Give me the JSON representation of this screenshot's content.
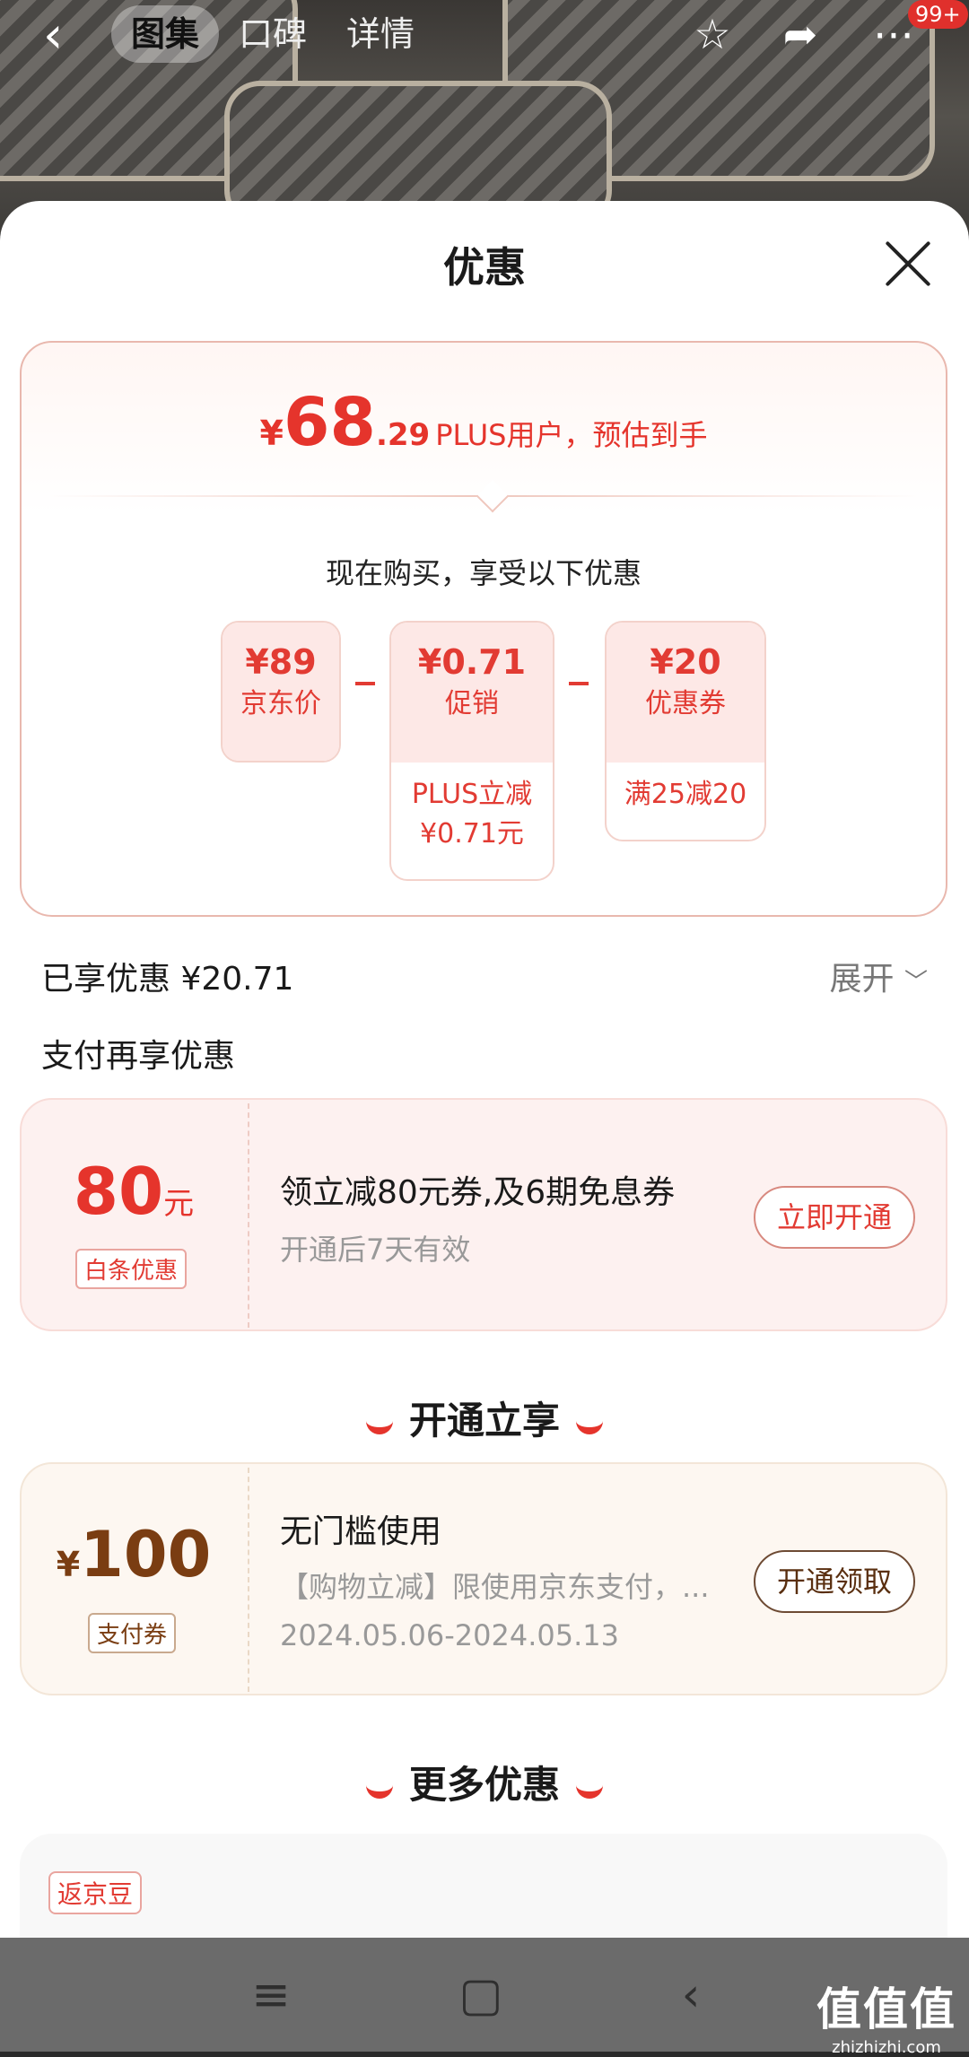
{
  "header": {
    "tabs": [
      "图集",
      "口碑",
      "详情"
    ],
    "active_tab": 0,
    "cart_badge": "99+"
  },
  "sheet": {
    "title": "优惠",
    "estimate": {
      "yen": "¥",
      "integer": "68",
      "decimal": ".29",
      "label": "PLUS用户，预估到手"
    },
    "buy_now_text": "现在购买，享受以下优惠",
    "breakdown": [
      {
        "amount": "¥89",
        "label": "京东价",
        "detail": ""
      },
      {
        "amount": "¥0.71",
        "label": "促销",
        "detail": "PLUS立减\n¥0.71元"
      },
      {
        "amount": "¥20",
        "label": "优惠券",
        "detail": "满25减20"
      }
    ],
    "enjoyed": "已享优惠 ¥20.71",
    "expand": "展开",
    "pay_more": "支付再享优惠"
  },
  "baitiao_coupon": {
    "amount": "80",
    "unit": "元",
    "tag": "白条优惠",
    "title": "领立减80元券,及6期免息券",
    "desc": "开通后7天有效",
    "button": "立即开通"
  },
  "section_open": "开通立享",
  "pay_coupon": {
    "currency": "¥",
    "amount": "100",
    "tag": "支付券",
    "title": "无门槛使用",
    "desc": "【购物立减】限使用京东支付，...",
    "dates": "2024.05.06-2024.05.13",
    "button": "开通领取"
  },
  "section_more": "更多优惠",
  "more": {
    "tag": "返京豆"
  },
  "watermark": {
    "big": "值值值",
    "small": "zhizhizhi.com"
  },
  "colors": {
    "accent": "#e5342c",
    "brown": "#7a3d12"
  }
}
